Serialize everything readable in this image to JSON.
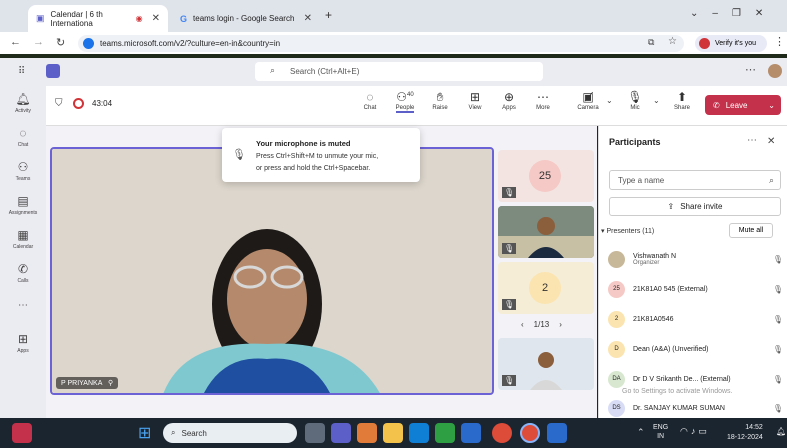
{
  "browser": {
    "tabs": [
      {
        "title": "Calendar | 6 th Internationa",
        "active": true
      },
      {
        "title": "teams login - Google Search",
        "active": false
      }
    ],
    "new_tab": "+",
    "url": "teams.microsoft.com/v2/?culture=en-in&country=in",
    "verify_label": "Verify it's you",
    "window_controls": [
      "⌄",
      "–",
      "❐",
      "✕"
    ]
  },
  "teams": {
    "search_placeholder": "Search (Ctrl+Alt+E)",
    "more": "⋯",
    "rail": [
      {
        "label": "Activity",
        "icon": "bell-icon"
      },
      {
        "label": "Chat",
        "icon": "chat-icon"
      },
      {
        "label": "Teams",
        "icon": "teams-icon"
      },
      {
        "label": "Assignments",
        "icon": "assignments-icon"
      },
      {
        "label": "Calendar",
        "icon": "calendar-icon"
      },
      {
        "label": "Calls",
        "icon": "phone-icon"
      },
      {
        "label": "⋯",
        "icon": "more-icon"
      },
      {
        "label": "Apps",
        "icon": "apps-icon"
      }
    ]
  },
  "meeting": {
    "timer": "43:04",
    "controls": [
      {
        "label": "Chat",
        "icon": "chat-icon"
      },
      {
        "label": "People",
        "icon": "people-icon",
        "count": "40"
      },
      {
        "label": "Raise",
        "icon": "hand-icon"
      },
      {
        "label": "View",
        "icon": "view-icon"
      },
      {
        "label": "Apps",
        "icon": "apps-icon"
      },
      {
        "label": "More",
        "icon": "more-icon"
      },
      {
        "label": "Camera",
        "icon": "camera-off-icon"
      },
      {
        "label": "Mic",
        "icon": "mic-off-icon"
      },
      {
        "label": "Share",
        "icon": "share-icon"
      }
    ],
    "leave_label": "Leave",
    "toast": {
      "title": "Your microphone is muted",
      "line1": "Press Ctrl+Shift+M to unmute your mic,",
      "line2": "or press and hold the Ctrl+Spacebar."
    },
    "main_video_name": "P PRIYANKA",
    "tiles": [
      "25",
      "",
      "2",
      ""
    ],
    "pagination": "1/13"
  },
  "participants": {
    "title": "Participants",
    "search_placeholder": "Type a name",
    "share_invite": "Share invite",
    "presenters_label": "Presenters (11)",
    "mute_all": "Mute all",
    "list": [
      {
        "name": "Vishwanath N",
        "sub": "Organizer",
        "avatar": "",
        "color": "#c8b89a"
      },
      {
        "name": "21K81A0 545 (External)",
        "sub": "",
        "avatar": "25",
        "color": "#f5c9c5"
      },
      {
        "name": "21K81A0546",
        "sub": "",
        "avatar": "2",
        "color": "#fbe4b0"
      },
      {
        "name": "Dean (A&A) (Unverified)",
        "sub": "",
        "avatar": "D",
        "color": "#fbe4b0"
      },
      {
        "name": "Dr D V Srikanth De...  (External)",
        "sub": "",
        "avatar": "DA",
        "color": "#d8e8d0"
      },
      {
        "name": "Dr. SANJAY KUMAR SUMAN",
        "sub": "",
        "avatar": "DS",
        "color": "#d8dcf5"
      }
    ],
    "watermark": "Go to Settings to activate Windows."
  },
  "taskbar": {
    "search": "Search",
    "lang": "ENG",
    "region": "IN",
    "time": "14:52",
    "date": "18-12-2024"
  }
}
